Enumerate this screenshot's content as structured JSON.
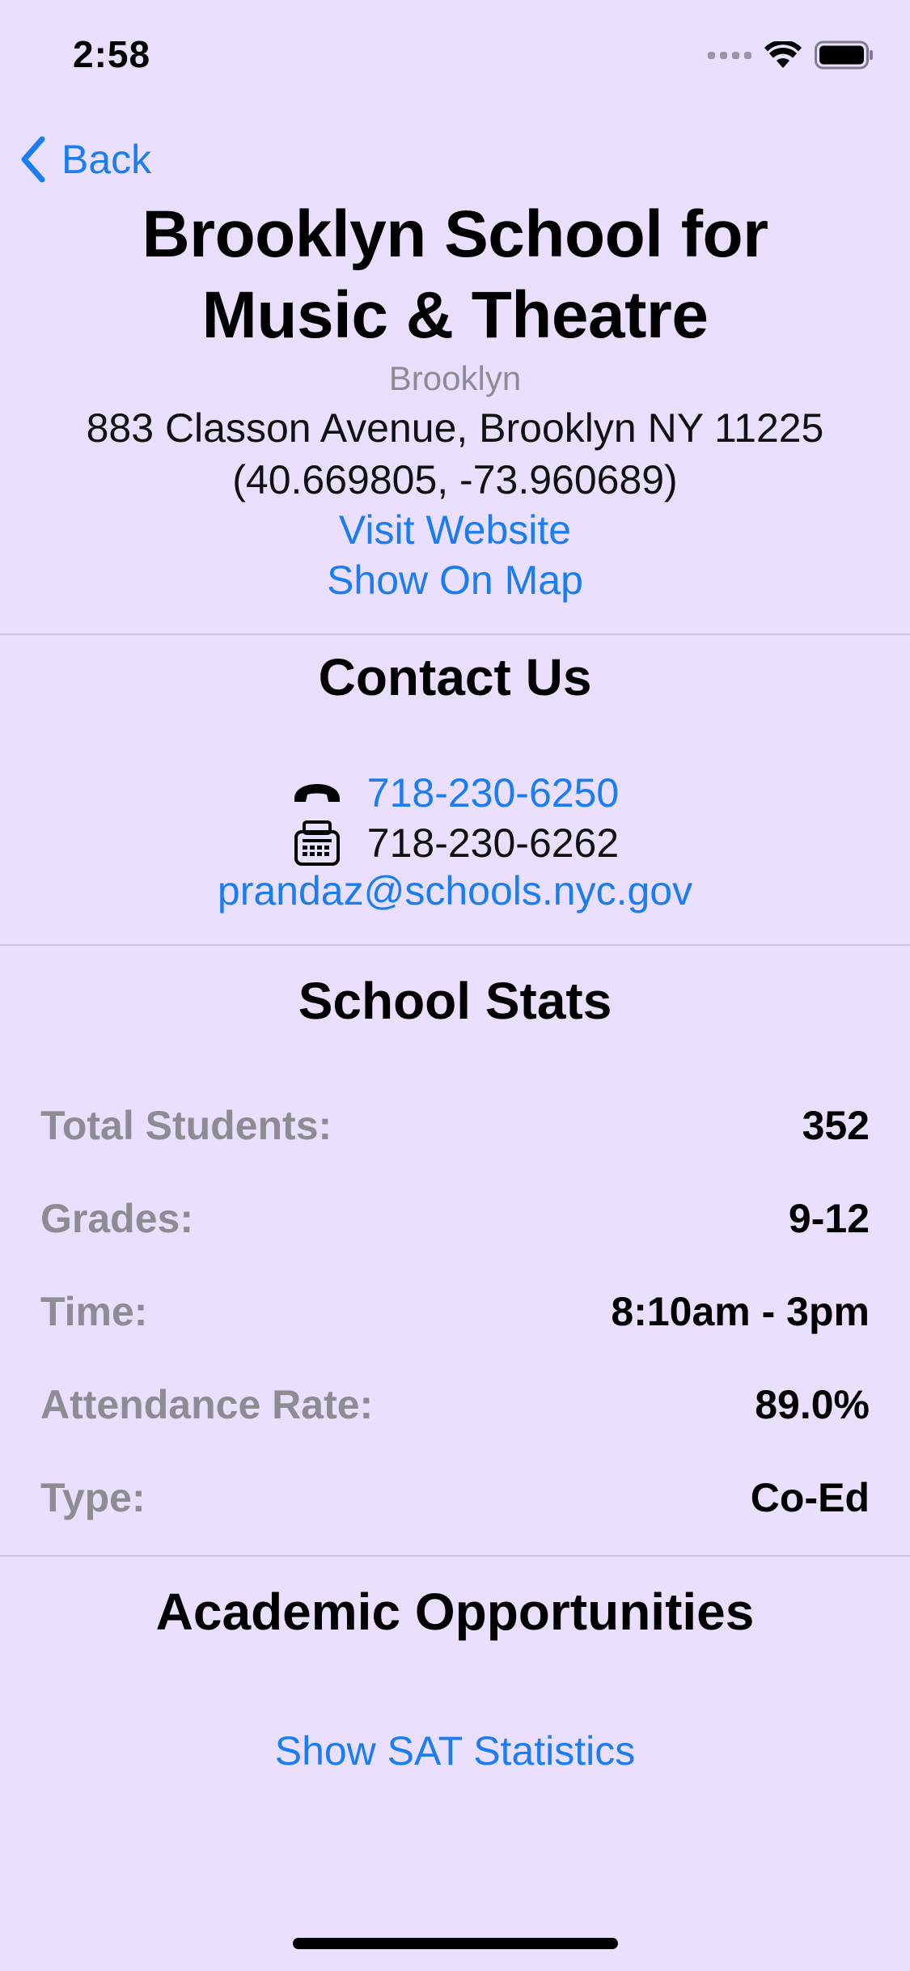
{
  "status_bar": {
    "time": "2:58"
  },
  "nav": {
    "back_label": "Back"
  },
  "school": {
    "name_line1": "Brooklyn School for",
    "name_line2": "Music & Theatre",
    "borough": "Brooklyn",
    "address": "883 Classon Avenue, Brooklyn NY 11225",
    "coordinates": "(40.669805, -73.960689)",
    "website_link": "Visit Website",
    "map_link": "Show On Map"
  },
  "contact": {
    "heading": "Contact Us",
    "phone": "718-230-6250",
    "fax": "718-230-6262",
    "email": "prandaz@schools.nyc.gov"
  },
  "stats": {
    "heading": "School Stats",
    "rows": [
      {
        "label": "Total Students:",
        "value": "352"
      },
      {
        "label": "Grades:",
        "value": "9-12"
      },
      {
        "label": "Time:",
        "value": "8:10am - 3pm"
      },
      {
        "label": "Attendance Rate:",
        "value": "89.0%"
      },
      {
        "label": "Type:",
        "value": "Co-Ed"
      }
    ]
  },
  "academics": {
    "heading": "Academic Opportunities",
    "sat_link": "Show SAT Statistics"
  },
  "colors": {
    "background": "#EADFFF",
    "accent": "#1A7DF0",
    "secondary_text": "#8E8B93"
  },
  "icons": [
    "chevron-left-icon",
    "phone-icon",
    "fax-icon",
    "wifi-icon",
    "battery-icon",
    "cellular-signal-icon"
  ]
}
